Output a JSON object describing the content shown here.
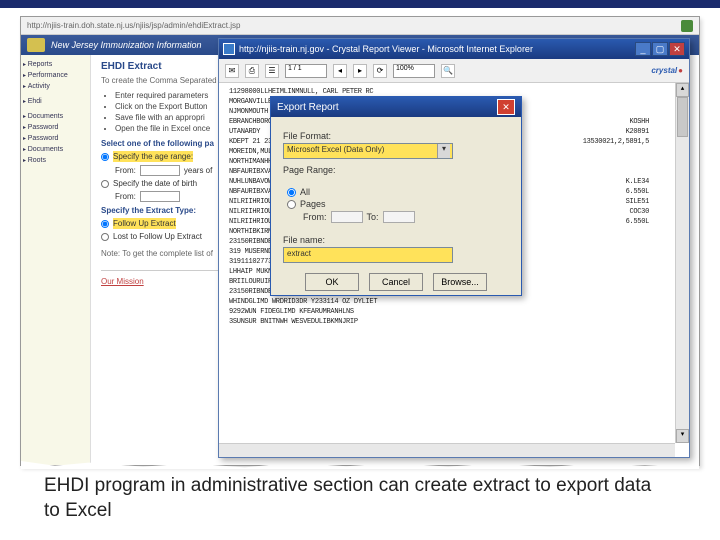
{
  "back": {
    "addr": "http://njiis-train.doh.state.nj.us/njiis/jsp/admin/ehdiExtract.jsp",
    "banner": "New Jersey Immunization Information",
    "heading": "EHDI Extract",
    "sub": "To create the Comma Separated",
    "bullets": [
      "Enter required parameters",
      "Click on the Export Button",
      "Save file with an appropri",
      "Open the file in Excel once"
    ],
    "select_label": "Select one of the following pa",
    "specify_age": "Specify the age range:",
    "from": "From:",
    "years_of": "years of",
    "specify_dob": "Specify the date of birth",
    "extract_type": "Specify the Extract Type:",
    "followup": "Follow Up Extract",
    "lost": "Lost to Follow Up Extract",
    "note": "Note: To get the complete list of",
    "mission": "Our Mission"
  },
  "sidebar": {
    "items": [
      "",
      "Reports",
      "Performance",
      "Activity",
      "",
      "Ehdi",
      "",
      "Documents",
      "Password",
      "Password",
      "Documents",
      "Roots"
    ]
  },
  "crv": {
    "title": "http://njiis-train.nj.gov - Crystal Report Viewer - Microsoft Internet Explorer",
    "zoom": "100%",
    "page": "1 / 1",
    "logo": "crystal",
    "lines": [
      [
        "11298000LLHEIMLINMNULL,  CARL PETER  RC",
        ""
      ],
      [
        "MORGANVILLENJNULLNULLNULLNULLU",
        ""
      ],
      [
        "NJMONMOUTH COUNTY",
        ""
      ],
      [
        "EBRANCHBORO 25",
        "KOSHH"
      ],
      [
        "UTANARDY",
        "K20891"
      ],
      [
        "KDEPT 21   23",
        "13530021,2,5891,5"
      ],
      [
        "MOREIDN,MULD-MUTULLU",
        ""
      ],
      [
        "NORTHIMANHHIPM.THEUULLU",
        ""
      ],
      [
        "NBFAURIBXVALD-WITULLU1121120300   6.550L",
        ""
      ],
      [
        "NUHLUNBAVOWERHedalLU",
        "K.LE34"
      ],
      [
        "NBFAURIBXVALD-WITULLU",
        "6.550L"
      ],
      [
        "NILRIIHRIOUNLULLL",
        "SILE51"
      ],
      [
        "NILRIIHRIOUNLULLL",
        "COC30"
      ],
      [
        "NILRIIHRIOUNLULLL",
        "6.550L"
      ],
      [
        "NORTHIBKIRMLDPM T 4    L122357032L1,5 88,978,",
        ""
      ],
      [
        "23150RIBNDERWHITBURK L2008    1    LCSTD1",
        ""
      ],
      [
        "319 MUSERNDUMEHANNUXRANTOP  D     102223R220813HH09K",
        ""
      ],
      [
        "319111027739DLSBIJWL M    ANSCORDLDCENTER",
        ""
      ],
      [
        "LHHAIP MUKNIBPJSBHHA454A,A",
        ""
      ],
      [
        "BRIILOURUIRONDMAT  D    21 er int 10RESN389 t.orne    RALLI1",
        ""
      ],
      [
        "23150RIBNDERWHITBURK LU1     122387032L1,5 88,978,",
        ""
      ],
      [
        "WHINDGLIMD WRDRID3DR Y233114 OZ DYLIET",
        ""
      ],
      [
        "9292WUN FIDEGLIMD KFEARUMRANHLNS",
        ""
      ],
      [
        "3SUNSUR BNITNWH WESVEDULIBKMNJRIP",
        ""
      ]
    ]
  },
  "export": {
    "title": "Export Report",
    "format_label": "File Format:",
    "format_value": "Microsoft Excel (Data Only)",
    "range_label": "Page Range:",
    "all": "All",
    "pages": "Pages",
    "from": "From:",
    "to": "To:",
    "filename_label": "File name:",
    "filename_value": "extract",
    "ok": "OK",
    "cancel": "Cancel",
    "browse": "Browse..."
  },
  "caption": "EHDI program in administrative section can create extract to export data to Excel"
}
